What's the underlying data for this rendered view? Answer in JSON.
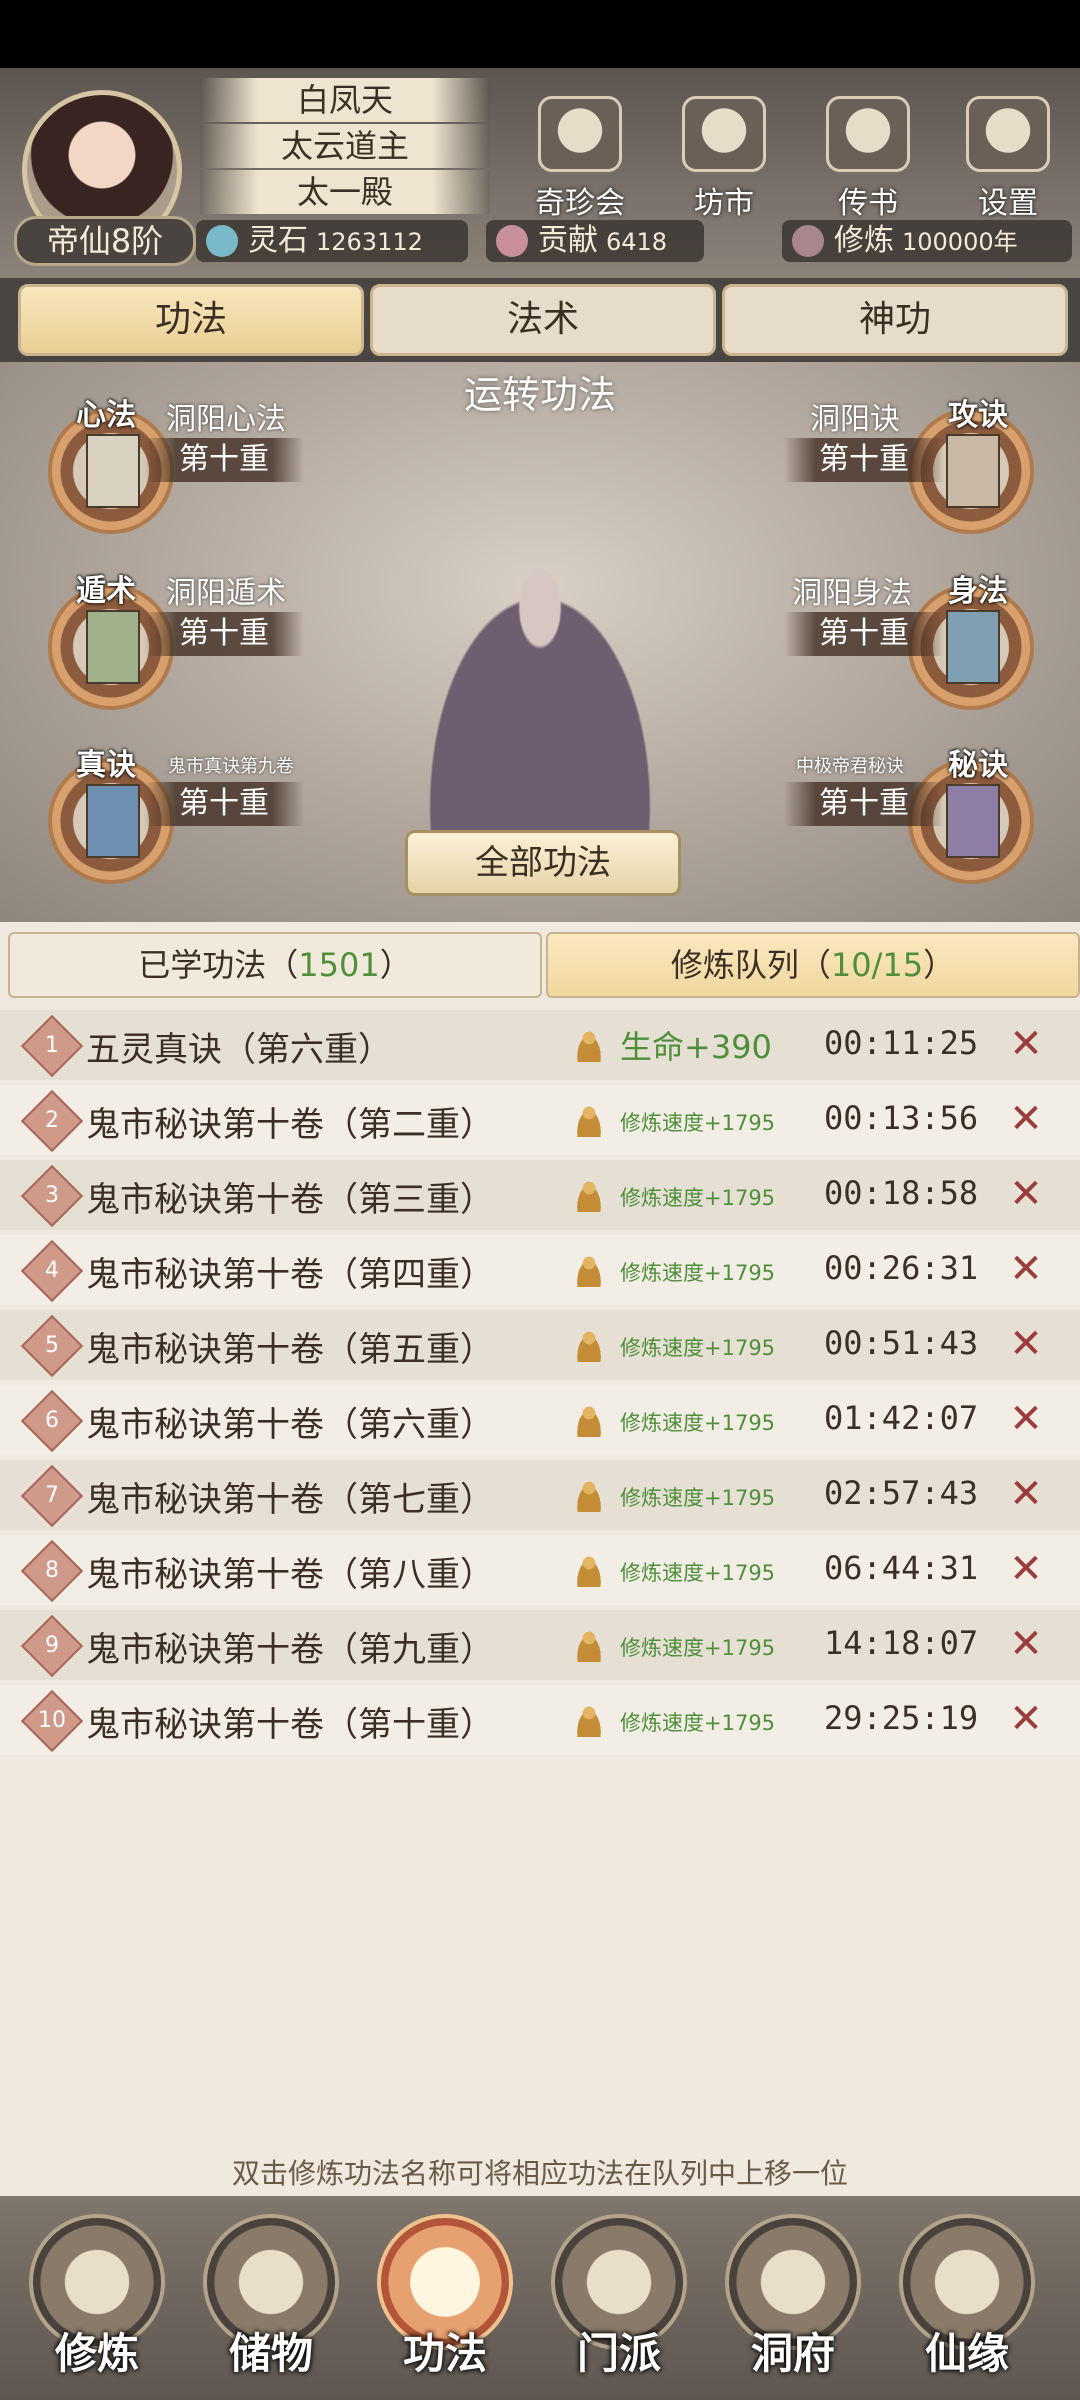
{
  "header": {
    "rank": "帝仙8阶",
    "titles": [
      "白凤天",
      "太云道主",
      "太一殿"
    ],
    "menu": [
      {
        "label": "奇珍会",
        "icon": "treasure-pavilion-icon"
      },
      {
        "label": "坊市",
        "icon": "market-icon"
      },
      {
        "label": "传书",
        "icon": "scroll-letter-icon"
      },
      {
        "label": "设置",
        "icon": "gear-icon"
      }
    ],
    "resources": [
      {
        "label": "灵石",
        "value": "1263112",
        "icon": "spirit-stone-icon"
      },
      {
        "label": "贡献",
        "value": "6418",
        "icon": "contribution-icon"
      },
      {
        "label": "修炼",
        "value": "100000年",
        "icon": "cultivation-icon"
      }
    ]
  },
  "tabs": [
    "功法",
    "法术",
    "神功"
  ],
  "active_tab": "功法",
  "stage": {
    "title": "运转功法",
    "slots": [
      {
        "type": "心法",
        "name": "洞阳心法",
        "level": "第十重",
        "stars": 2,
        "book_color": "#d9d2c0"
      },
      {
        "type": "攻诀",
        "name": "洞阳诀",
        "level": "第十重",
        "stars": 2,
        "book_color": "#c9b8a4"
      },
      {
        "type": "遁术",
        "name": "洞阳遁术",
        "level": "第十重",
        "stars": 2,
        "book_color": "#9fb08a"
      },
      {
        "type": "身法",
        "name": "洞阳身法",
        "level": "第十重",
        "stars": 2,
        "book_color": "#7f9fb2"
      },
      {
        "type": "真诀",
        "name": "鬼市真诀第九卷",
        "level": "第十重",
        "stars": 1,
        "book_color": "#6f8fb0"
      },
      {
        "type": "秘诀",
        "name": "中极帝君秘诀",
        "level": "第十重",
        "stars": 4,
        "book_color": "#8f7fa6"
      }
    ],
    "all_button": "全部功法"
  },
  "subtabs": {
    "learned_label": "已学功法",
    "learned_count": "1501",
    "queue_label": "修炼队列",
    "queue_count": "10/15"
  },
  "queue": [
    {
      "num": "1",
      "name": "五灵真诀（第六重）",
      "bonus": "生命+390",
      "time": "00:11:25",
      "big": true
    },
    {
      "num": "2",
      "name": "鬼市秘诀第十卷（第二重）",
      "bonus": "修炼速度+1795",
      "time": "00:13:56"
    },
    {
      "num": "3",
      "name": "鬼市秘诀第十卷（第三重）",
      "bonus": "修炼速度+1795",
      "time": "00:18:58"
    },
    {
      "num": "4",
      "name": "鬼市秘诀第十卷（第四重）",
      "bonus": "修炼速度+1795",
      "time": "00:26:31"
    },
    {
      "num": "5",
      "name": "鬼市秘诀第十卷（第五重）",
      "bonus": "修炼速度+1795",
      "time": "00:51:43"
    },
    {
      "num": "6",
      "name": "鬼市秘诀第十卷（第六重）",
      "bonus": "修炼速度+1795",
      "time": "01:42:07"
    },
    {
      "num": "7",
      "name": "鬼市秘诀第十卷（第七重）",
      "bonus": "修炼速度+1795",
      "time": "02:57:43"
    },
    {
      "num": "8",
      "name": "鬼市秘诀第十卷（第八重）",
      "bonus": "修炼速度+1795",
      "time": "06:44:31"
    },
    {
      "num": "9",
      "name": "鬼市秘诀第十卷（第九重）",
      "bonus": "修炼速度+1795",
      "time": "14:18:07"
    },
    {
      "num": "10",
      "name": "鬼市秘诀第十卷（第十重）",
      "bonus": "修炼速度+1795",
      "time": "29:25:19"
    }
  ],
  "hint": "双击修炼功法名称可将相应功法在队列中上移一位",
  "bottom_nav": [
    {
      "label": "修炼",
      "icon": "cultivate-icon"
    },
    {
      "label": "储物",
      "icon": "storage-bag-icon"
    },
    {
      "label": "功法",
      "icon": "technique-scroll-icon"
    },
    {
      "label": "门派",
      "icon": "sect-gate-icon"
    },
    {
      "label": "洞府",
      "icon": "cave-abode-icon"
    },
    {
      "label": "仙缘",
      "icon": "immortal-fate-icon"
    }
  ],
  "colors": {
    "accent_green": "#4f8f3a",
    "close_red": "#9b3c3c",
    "active_tab": "#f0d79f"
  }
}
